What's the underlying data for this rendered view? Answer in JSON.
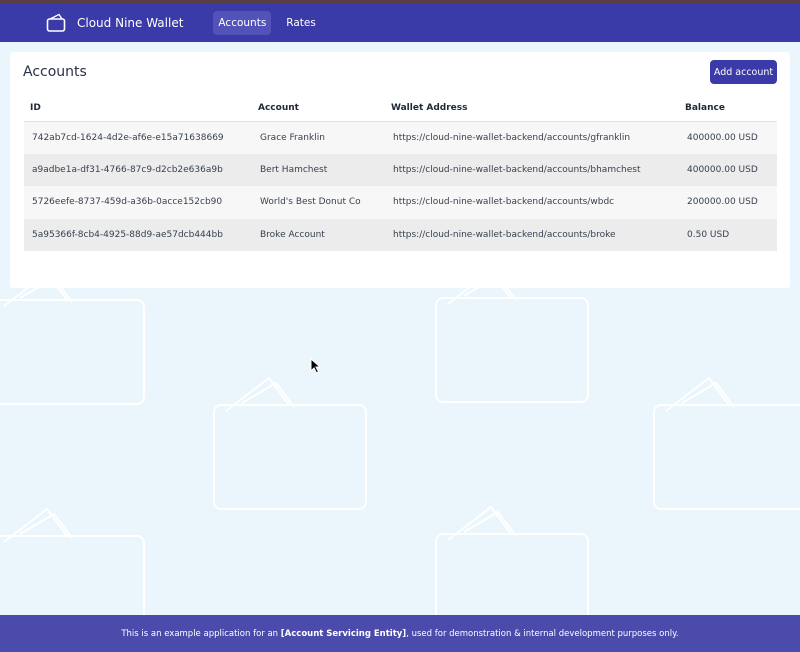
{
  "app": {
    "name": "Cloud Nine Wallet",
    "brand_icon": "wallet-icon"
  },
  "nav": {
    "items": [
      {
        "label": "Accounts",
        "active": true
      },
      {
        "label": "Rates",
        "active": false
      }
    ]
  },
  "accounts": {
    "title": "Accounts",
    "add_button_label": "Add account",
    "columns": [
      "ID",
      "Account",
      "Wallet Address",
      "Balance"
    ],
    "rows": [
      {
        "id": "742ab7cd-1624-4d2e-af6e-e15a71638669",
        "account": "Grace Franklin",
        "wallet": "https://cloud-nine-wallet-backend/accounts/gfranklin",
        "balance": "400000.00 USD"
      },
      {
        "id": "a9adbe1a-df31-4766-87c9-d2cb2e636a9b",
        "account": "Bert Hamchest",
        "wallet": "https://cloud-nine-wallet-backend/accounts/bhamchest",
        "balance": "400000.00 USD"
      },
      {
        "id": "5726eefe-8737-459d-a36b-0acce152cb90",
        "account": "World's Best Donut Co",
        "wallet": "https://cloud-nine-wallet-backend/accounts/wbdc",
        "balance": "200000.00 USD"
      },
      {
        "id": "5a95366f-8cb4-4925-88d9-ae57dcb444bb",
        "account": "Broke Account",
        "wallet": "https://cloud-nine-wallet-backend/accounts/broke",
        "balance": "0.50 USD"
      }
    ]
  },
  "footer": {
    "prefix": "This is an example application for an ",
    "entity": "[Account Servicing Entity]",
    "suffix": ", used for demonstration & internal development purposes only."
  },
  "colors": {
    "primary": "#3a3aa8",
    "footer": "#4b4bac",
    "background": "#eaf6fc"
  }
}
